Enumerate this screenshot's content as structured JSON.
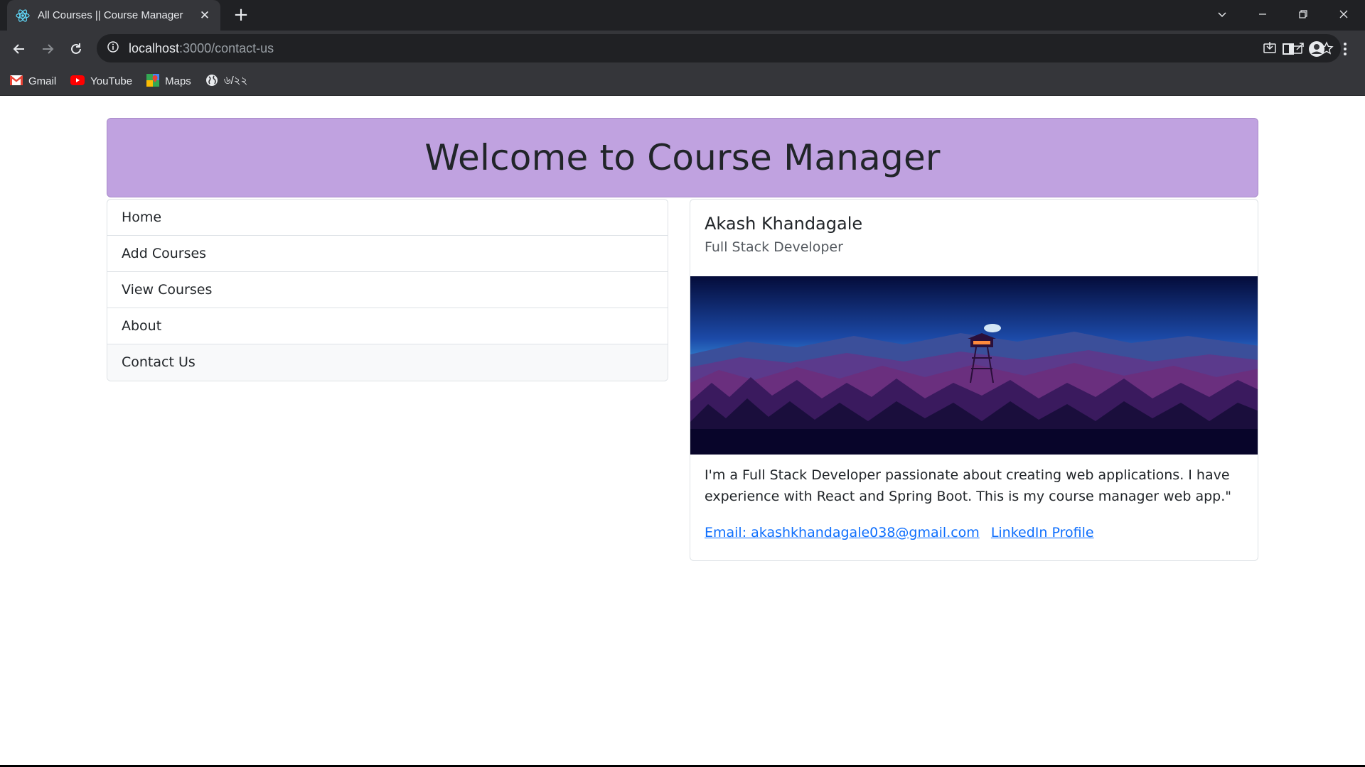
{
  "browser": {
    "tab_title": "All Courses || Course Manager",
    "url_host": "localhost",
    "url_path": ":3000/contact-us",
    "bookmarks": [
      {
        "label": "Gmail",
        "icon": "gmail-icon"
      },
      {
        "label": "YouTube",
        "icon": "youtube-icon"
      },
      {
        "label": "Maps",
        "icon": "maps-icon"
      },
      {
        "label": "৬/২২",
        "icon": "globe-icon"
      }
    ]
  },
  "header": {
    "title": "Welcome to Course Manager"
  },
  "menu": {
    "items": [
      {
        "label": "Home"
      },
      {
        "label": "Add Courses"
      },
      {
        "label": "View Courses"
      },
      {
        "label": "About"
      },
      {
        "label": "Contact Us",
        "active": true
      }
    ]
  },
  "profile": {
    "name": "Akash Khandagale",
    "role": "Full Stack Developer",
    "bio": "I'm a Full Stack Developer passionate about creating web applications. I have experience with React and Spring Boot. This is my course manager web app.\"",
    "email_label": "Email: akashkhandagale038@gmail.com",
    "linkedin_label": "LinkedIn Profile"
  },
  "colors": {
    "header_bg": "#c0a2e0",
    "link": "#0d6efd",
    "chrome_dark": "#202124",
    "chrome_mid": "#35363a"
  }
}
